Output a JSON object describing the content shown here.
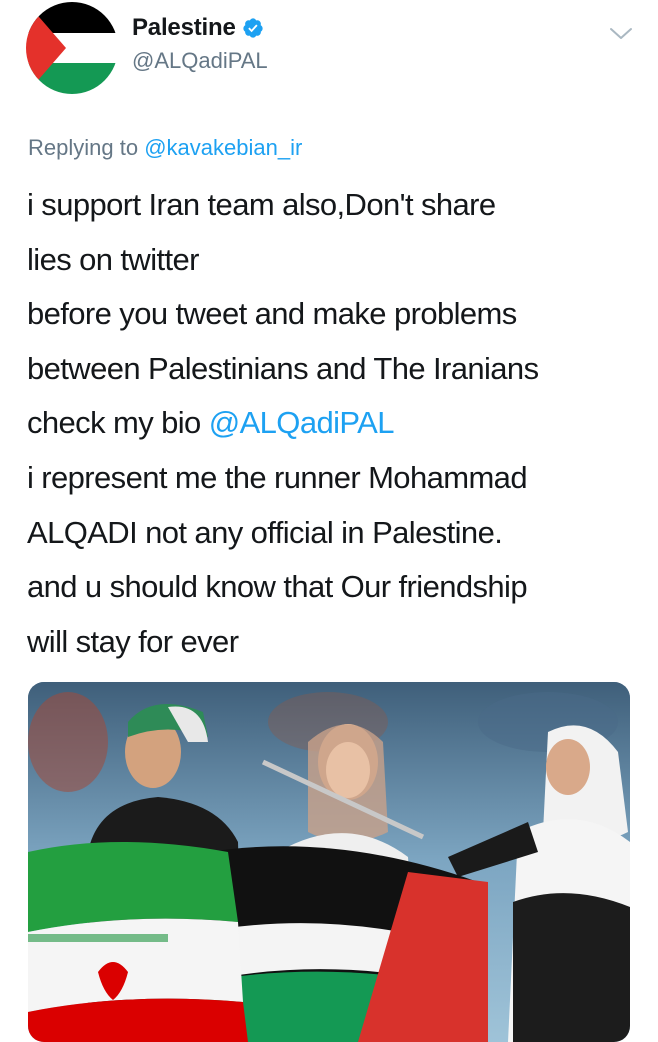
{
  "author": {
    "display_name": "Palestine",
    "handle": "@ALQadiPAL",
    "verified": true,
    "avatar_icon": "palestine-flag-avatar"
  },
  "reply": {
    "prefix": "Replying to",
    "mention": "@kavakebian_ir"
  },
  "tweet": {
    "lines": [
      "i support Iran team also,Don't share",
      "lies on twitter",
      "before you tweet and make problems",
      "between Palestinians and The Iranians",
      "check my bio",
      "i represent me the runner Mohammad",
      "ALQADI not any official in Palestine.",
      "and u should know that Our friendship",
      "will stay for ever"
    ],
    "bio_mention": "@ALQadiPAL"
  },
  "colors": {
    "link": "#1da1f2",
    "secondary_text": "#657786",
    "primary_text": "#14171a",
    "flag_black": "#000000",
    "flag_green": "#149954",
    "flag_red": "#e4312b"
  },
  "icons": {
    "verified": "verified-badge-icon",
    "menu": "chevron-down-icon"
  }
}
